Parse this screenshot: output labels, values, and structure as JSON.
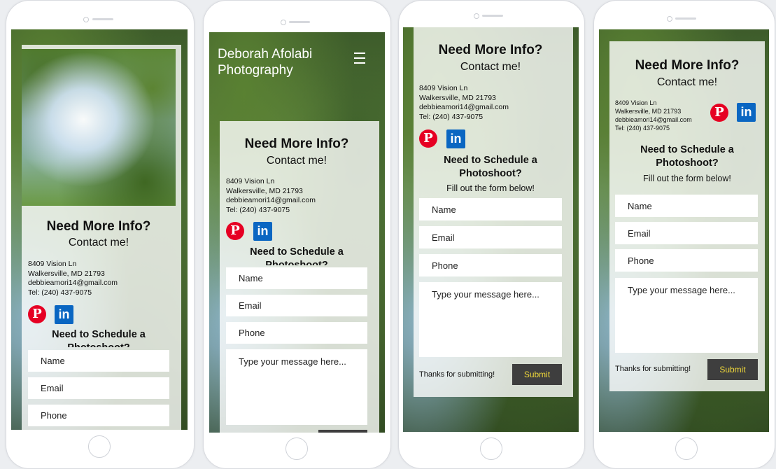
{
  "site": {
    "title": "Deborah Afolabi Photography",
    "title_line1": "Deborah Afolabi",
    "title_line2": "Photography"
  },
  "contact": {
    "heading": "Need More Info?",
    "subheading": "Contact me!",
    "address_line1": "8409 Vision Ln",
    "address_line2": "Walkersville, MD 21793",
    "email": "debbieamori14@gmail.com",
    "phone": "Tel: (240) 437-9075"
  },
  "social": {
    "pinterest_glyph": "P",
    "linkedin_glyph": "in"
  },
  "schedule": {
    "heading_line1": "Need to Schedule a",
    "heading_line2": "Photoshoot?",
    "fill_text": "Fill out the form below!"
  },
  "form": {
    "name_placeholder": "Name",
    "email_placeholder": "Email",
    "phone_placeholder": "Phone",
    "message_placeholder": "Type your message here...",
    "thanks_text": "Thanks for submitting!",
    "submit_label": "Submit"
  },
  "colors": {
    "pinterest": "#e60023",
    "linkedin": "#0a66c2",
    "submit_bg": "#3e3e3e",
    "submit_text": "#f0d83a"
  }
}
